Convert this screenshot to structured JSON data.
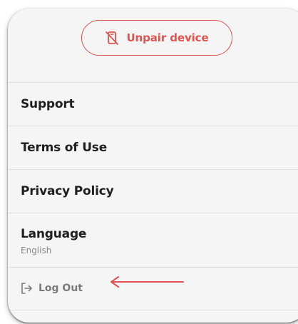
{
  "unpair": {
    "label": "Unpair device",
    "icon": "phone-off-icon"
  },
  "menu": {
    "support": "Support",
    "terms": "Terms of Use",
    "privacy": "Privacy Policy",
    "language_label": "Language",
    "language_value": "English"
  },
  "logout": {
    "label": "Log Out",
    "icon": "logout-icon"
  },
  "colors": {
    "accent": "#e0524d",
    "card_background": "#f5f5f5",
    "divider": "#dedede",
    "muted_text": "#7a7a7a"
  }
}
